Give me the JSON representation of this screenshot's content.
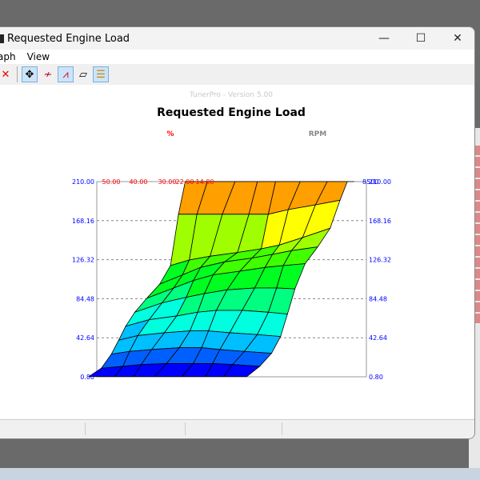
{
  "window": {
    "title": "Requested Engine Load",
    "minimize": "—",
    "maximize": "☐",
    "close": "✕"
  },
  "menu": {
    "items": [
      "aph",
      "View"
    ]
  },
  "toolbar": {
    "tools": [
      {
        "icon": "close-x-icon",
        "glyph": "✕"
      },
      {
        "icon": "move-icon",
        "glyph": "✥"
      },
      {
        "icon": "line-graph-icon",
        "glyph": "≁"
      },
      {
        "icon": "graph-2d-icon",
        "glyph": "⩘"
      },
      {
        "icon": "surface-3d-icon",
        "glyph": "▱"
      },
      {
        "icon": "legend-icon",
        "glyph": "☰"
      }
    ]
  },
  "chart_data": {
    "type": "surface",
    "watermark": "TunerPro - Version 5.00",
    "title": "Requested Engine Load",
    "xlabel": "%",
    "ylabel": "RPM",
    "x_tick_labels": [
      "50.00",
      "40.00",
      "30.00",
      "22.00",
      "14.00"
    ],
    "right_top_label": "8500",
    "z_ticks": [
      "0.80",
      "42.64",
      "84.48",
      "126.32",
      "168.16",
      "210.00"
    ],
    "zlim": [
      0.8,
      210
    ],
    "grid": true,
    "z_values": [
      [
        1,
        1,
        1,
        1,
        1,
        1,
        1,
        1
      ],
      [
        10,
        12,
        14,
        15,
        15,
        15,
        14,
        12
      ],
      [
        25,
        28,
        30,
        32,
        32,
        30,
        28,
        26
      ],
      [
        40,
        45,
        48,
        50,
        50,
        48,
        46,
        44
      ],
      [
        55,
        62,
        66,
        70,
        72,
        72,
        70,
        68
      ],
      [
        70,
        80,
        86,
        90,
        94,
        96,
        96,
        95
      ],
      [
        85,
        96,
        104,
        110,
        114,
        118,
        120,
        122
      ],
      [
        100,
        110,
        118,
        124,
        128,
        132,
        136,
        140
      ],
      [
        120,
        126,
        130,
        134,
        138,
        142,
        150,
        160
      ],
      [
        175,
        175,
        175,
        175,
        175,
        180,
        185,
        190
      ],
      [
        210,
        210,
        210,
        210,
        210,
        210,
        210,
        210
      ],
      [
        210,
        210,
        210,
        210,
        210,
        210,
        210,
        210
      ]
    ],
    "colors": {
      "tick_z": "#0000ff",
      "tick_x": "#ff0000",
      "grid": "#888888"
    }
  }
}
